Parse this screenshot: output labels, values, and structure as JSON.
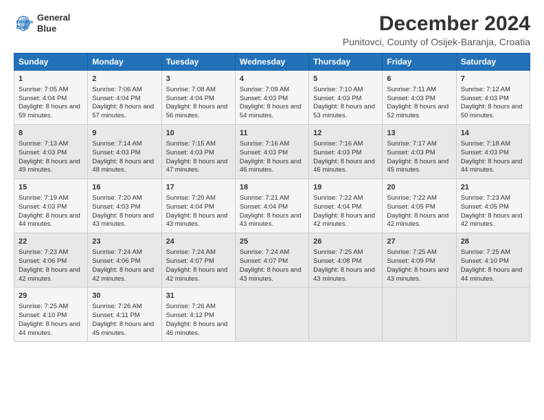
{
  "logo": {
    "line1": "General",
    "line2": "Blue"
  },
  "title": "December 2024",
  "location": "Punitovci, County of Osijek-Baranja, Croatia",
  "headers": [
    "Sunday",
    "Monday",
    "Tuesday",
    "Wednesday",
    "Thursday",
    "Friday",
    "Saturday"
  ],
  "weeks": [
    [
      {
        "day": "1",
        "sunrise": "Sunrise: 7:05 AM",
        "sunset": "Sunset: 4:04 PM",
        "daylight": "Daylight: 8 hours and 59 minutes."
      },
      {
        "day": "2",
        "sunrise": "Sunrise: 7:06 AM",
        "sunset": "Sunset: 4:04 PM",
        "daylight": "Daylight: 8 hours and 57 minutes."
      },
      {
        "day": "3",
        "sunrise": "Sunrise: 7:08 AM",
        "sunset": "Sunset: 4:04 PM",
        "daylight": "Daylight: 8 hours and 56 minutes."
      },
      {
        "day": "4",
        "sunrise": "Sunrise: 7:09 AM",
        "sunset": "Sunset: 4:03 PM",
        "daylight": "Daylight: 8 hours and 54 minutes."
      },
      {
        "day": "5",
        "sunrise": "Sunrise: 7:10 AM",
        "sunset": "Sunset: 4:03 PM",
        "daylight": "Daylight: 8 hours and 53 minutes."
      },
      {
        "day": "6",
        "sunrise": "Sunrise: 7:11 AM",
        "sunset": "Sunset: 4:03 PM",
        "daylight": "Daylight: 8 hours and 52 minutes."
      },
      {
        "day": "7",
        "sunrise": "Sunrise: 7:12 AM",
        "sunset": "Sunset: 4:03 PM",
        "daylight": "Daylight: 8 hours and 50 minutes."
      }
    ],
    [
      {
        "day": "8",
        "sunrise": "Sunrise: 7:13 AM",
        "sunset": "Sunset: 4:03 PM",
        "daylight": "Daylight: 8 hours and 49 minutes."
      },
      {
        "day": "9",
        "sunrise": "Sunrise: 7:14 AM",
        "sunset": "Sunset: 4:03 PM",
        "daylight": "Daylight: 8 hours and 48 minutes."
      },
      {
        "day": "10",
        "sunrise": "Sunrise: 7:15 AM",
        "sunset": "Sunset: 4:03 PM",
        "daylight": "Daylight: 8 hours and 47 minutes."
      },
      {
        "day": "11",
        "sunrise": "Sunrise: 7:16 AM",
        "sunset": "Sunset: 4:03 PM",
        "daylight": "Daylight: 8 hours and 46 minutes."
      },
      {
        "day": "12",
        "sunrise": "Sunrise: 7:16 AM",
        "sunset": "Sunset: 4:03 PM",
        "daylight": "Daylight: 8 hours and 46 minutes."
      },
      {
        "day": "13",
        "sunrise": "Sunrise: 7:17 AM",
        "sunset": "Sunset: 4:03 PM",
        "daylight": "Daylight: 8 hours and 45 minutes."
      },
      {
        "day": "14",
        "sunrise": "Sunrise: 7:18 AM",
        "sunset": "Sunset: 4:03 PM",
        "daylight": "Daylight: 8 hours and 44 minutes."
      }
    ],
    [
      {
        "day": "15",
        "sunrise": "Sunrise: 7:19 AM",
        "sunset": "Sunset: 4:03 PM",
        "daylight": "Daylight: 8 hours and 44 minutes."
      },
      {
        "day": "16",
        "sunrise": "Sunrise: 7:20 AM",
        "sunset": "Sunset: 4:03 PM",
        "daylight": "Daylight: 8 hours and 43 minutes."
      },
      {
        "day": "17",
        "sunrise": "Sunrise: 7:20 AM",
        "sunset": "Sunset: 4:04 PM",
        "daylight": "Daylight: 8 hours and 43 minutes."
      },
      {
        "day": "18",
        "sunrise": "Sunrise: 7:21 AM",
        "sunset": "Sunset: 4:04 PM",
        "daylight": "Daylight: 8 hours and 43 minutes."
      },
      {
        "day": "19",
        "sunrise": "Sunrise: 7:22 AM",
        "sunset": "Sunset: 4:04 PM",
        "daylight": "Daylight: 8 hours and 42 minutes."
      },
      {
        "day": "20",
        "sunrise": "Sunrise: 7:22 AM",
        "sunset": "Sunset: 4:05 PM",
        "daylight": "Daylight: 8 hours and 42 minutes."
      },
      {
        "day": "21",
        "sunrise": "Sunrise: 7:23 AM",
        "sunset": "Sunset: 4:05 PM",
        "daylight": "Daylight: 8 hours and 42 minutes."
      }
    ],
    [
      {
        "day": "22",
        "sunrise": "Sunrise: 7:23 AM",
        "sunset": "Sunset: 4:06 PM",
        "daylight": "Daylight: 8 hours and 42 minutes."
      },
      {
        "day": "23",
        "sunrise": "Sunrise: 7:24 AM",
        "sunset": "Sunset: 4:06 PM",
        "daylight": "Daylight: 8 hours and 42 minutes."
      },
      {
        "day": "24",
        "sunrise": "Sunrise: 7:24 AM",
        "sunset": "Sunset: 4:07 PM",
        "daylight": "Daylight: 8 hours and 42 minutes."
      },
      {
        "day": "25",
        "sunrise": "Sunrise: 7:24 AM",
        "sunset": "Sunset: 4:07 PM",
        "daylight": "Daylight: 8 hours and 43 minutes."
      },
      {
        "day": "26",
        "sunrise": "Sunrise: 7:25 AM",
        "sunset": "Sunset: 4:08 PM",
        "daylight": "Daylight: 8 hours and 43 minutes."
      },
      {
        "day": "27",
        "sunrise": "Sunrise: 7:25 AM",
        "sunset": "Sunset: 4:09 PM",
        "daylight": "Daylight: 8 hours and 43 minutes."
      },
      {
        "day": "28",
        "sunrise": "Sunrise: 7:25 AM",
        "sunset": "Sunset: 4:10 PM",
        "daylight": "Daylight: 8 hours and 44 minutes."
      }
    ],
    [
      {
        "day": "29",
        "sunrise": "Sunrise: 7:25 AM",
        "sunset": "Sunset: 4:10 PM",
        "daylight": "Daylight: 8 hours and 44 minutes."
      },
      {
        "day": "30",
        "sunrise": "Sunrise: 7:26 AM",
        "sunset": "Sunset: 4:11 PM",
        "daylight": "Daylight: 8 hours and 45 minutes."
      },
      {
        "day": "31",
        "sunrise": "Sunrise: 7:26 AM",
        "sunset": "Sunset: 4:12 PM",
        "daylight": "Daylight: 8 hours and 46 minutes."
      },
      null,
      null,
      null,
      null
    ]
  ]
}
